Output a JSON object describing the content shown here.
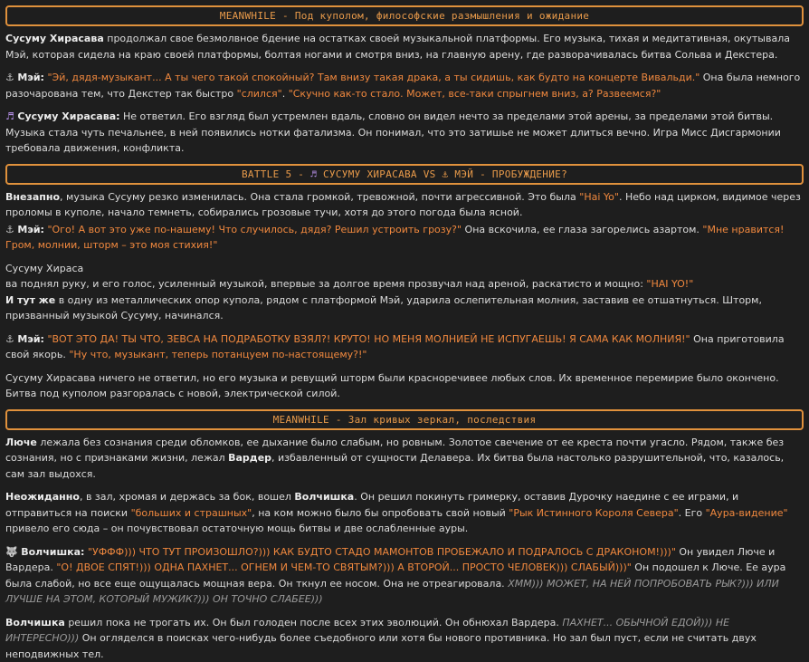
{
  "banner1": "MEANWHILE - Под куполом, философские размышления и ожидание",
  "p1": {
    "b1": "Сусуму Хирасава",
    "t1": " продолжал свое безмолвное бдение на остатках своей музыкальной платформы. Его музыка, тихая и медитативная, окутывала Мэй, которая сидела на краю своей платформы, болтая ногами и смотря вниз, на главную арену, где разворачивалась битва Сольва и Декстера."
  },
  "p2": {
    "icon": "⚓",
    "speaker": "Мэй:",
    "q1": "\"Эй, дядя-музыкант... А ты чего такой спокойный? Там внизу такая драка, а ты сидишь, как будто на концерте Вивальди.\"",
    "t1": " Она была немного разочарована тем, что Декстер так быстро ",
    "q2": "\"слился\"",
    "t2": ". ",
    "q3": "\"Скучно как-то стало. Может, все-таки спрыгнем вниз, а? Развеемся?\""
  },
  "p3": {
    "icon": "♬",
    "speaker": "Сусуму Хирасава:",
    "t1": " Не ответил. Его взгляд был устремлен вдаль, словно он видел нечто за пределами этой арены, за пределами этой битвы. Музыка стала чуть печальнее, в ней появились нотки фатализма. Он понимал, что это затишье не может длиться вечно. Игра Мисс Дисгармонии требовала движения, конфликта."
  },
  "banner2": {
    "t1": "BATTLE 5 - ",
    "icon1": "♬",
    "t2": " СУСУМУ ХИРАСАВА VS ",
    "icon2": "⚓",
    "t3": " МЭЙ - ПРОБУЖДЕНИЕ?"
  },
  "p4": {
    "b1": "Внезапно",
    "t1": ", музыка Сусуму резко изменилась. Она стала громкой, тревожной, почти агрессивной. Это была ",
    "q1": "\"Hai Yo\"",
    "t2": ". Небо над цирком, видимое через проломы в куполе, начало темнеть, собирались грозовые тучи, хотя до этого погода была ясной."
  },
  "p5": {
    "icon": "⚓",
    "speaker": "Мэй:",
    "q1": "\"Ого! А вот это уже по-нашему! Что случилось, дядя? Решил устроить грозу?\"",
    "t1": " Она вскочила, ее глаза загорелись азартом. ",
    "q2": "\"Мне нравится! Гром, молнии, шторм – это моя стихия!\""
  },
  "p6": {
    "l1": "Сусуму Хираса",
    "t1": "ва поднял руку, и его голос, усиленный музыкой, впервые за долгое время прозвучал над ареной, раскатисто и мощно: ",
    "q1": "\"HAI YO!\"",
    "b1": "И тут же",
    "t2": " в одну из металлических опор купола, рядом с платформой Мэй, ударила ослепительная молния, заставив ее отшатнуться. Шторм, призванный музыкой Сусуму, начинался."
  },
  "p7": {
    "icon": "⚓",
    "speaker": "Мэй:",
    "q1": "\"ВОТ ЭТО ДА! ТЫ ЧТО, ЗЕВСА НА ПОДРАБОТКУ ВЗЯЛ?! КРУТО! НО МЕНЯ МОЛНИЕЙ НЕ ИСПУГАЕШЬ! Я САМА КАК МОЛНИЯ!\"",
    "t1": " Она приготовила свой якорь. ",
    "q2": "\"Ну что, музыкант, теперь потанцуем по-настоящему?!\""
  },
  "p8": "Сусуму Хирасава ничего не ответил, но его музыка и ревущий шторм были красноречивее любых слов. Их временное перемирие было окончено. Битва под куполом разгоралась с новой, электрической силой.",
  "banner3": "MEANWHILE - Зал кривых зеркал, последствия",
  "p9": {
    "b1": "Люче",
    "t1": " лежала без сознания среди обломков, ее дыхание было слабым, но ровным. Золотое свечение от ее креста почти угасло. Рядом, также без сознания, но с признаками жизни, лежал ",
    "b2": "Вардер",
    "t2": ", избавленный от сущности Делавера. Их битва была настолько разрушительной, что, казалось, сам зал выдохся."
  },
  "p10": {
    "b1": "Неожиданно",
    "t1": ", в зал, хромая и держась за бок, вошел ",
    "b2": "Волчишка",
    "t2": ". Он решил покинуть гримерку, оставив Дурочку наедине с ее играми, и отправиться на поиски ",
    "q1": "\"больших и страшных\"",
    "t3": ", на ком можно было бы опробовать свой новый ",
    "q2": "\"Рык Истинного Короля Севера\"",
    "t4": ". Его ",
    "q3": "\"Аура-видение\"",
    "t5": " привело его сюда – он почувствовал остаточную мощь битвы и две ослабленные ауры."
  },
  "p11": {
    "icon": "🐺",
    "speaker": "Волчишка:",
    "q1": "\"УФФФ))) ЧТО ТУТ ПРОИЗОШЛО?))) КАК БУДТО СТАДО МАМОНТОВ ПРОБЕЖАЛО И ПОДРАЛОСЬ С ДРАКОНОМ!)))\"",
    "t1": " Он увидел Люче и Вардера. ",
    "q2": "\"О! ДВОЕ СПЯТ!))) ОДНА ПАХНЕТ... ОГНЕМ И ЧЕМ-ТО СВЯТЫМ?))) А ВТОРОЙ... ПРОСТО ЧЕЛОВЕК))) СЛАБЫЙ)))\"",
    "t2": " Он подошел к Люче. Ее аура была слабой, но все еще ощущалась мощная вера. Он ткнул ее носом. Она не отреагировала. ",
    "i1": "ХММ))) МОЖЕТ, НА НЕЙ ПОПРОБОВАТЬ РЫК?))) ИЛИ ЛУЧШЕ НА ЭТОМ, КОТОРЫЙ МУЖИК?))) ОН ТОЧНО СЛАБЕЕ)))"
  },
  "p12": {
    "b1": "Волчишка",
    "t1": " решил пока не трогать их. Он был голоден после всех этих эволюций. Он обнюхал Вардера. ",
    "i1": "ПАХНЕТ... ОБЫЧНОЙ ЕДОЙ))) НЕ ИНТЕРЕСНО)))",
    "t2": " Он огляделся в поисках чего-нибудь более съедобного или хотя бы нового противника. Но зал был пуст, если не считать двух неподвижных тел."
  }
}
